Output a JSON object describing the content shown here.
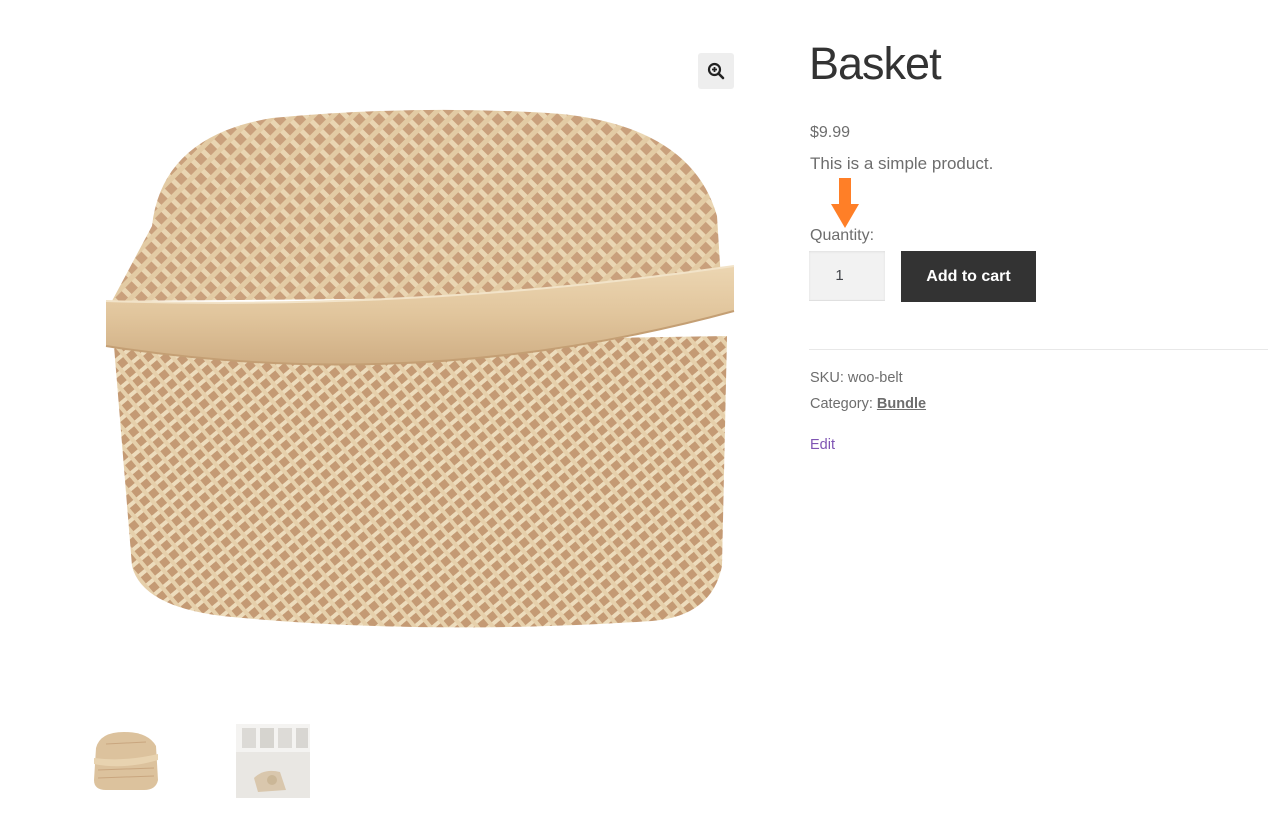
{
  "product": {
    "title": "Basket",
    "price": "$9.99",
    "short_description": "This is a simple product.",
    "quantity_label": "Quantity:",
    "quantity_value": "1",
    "add_to_cart_label": "Add to cart",
    "sku_label": "SKU:",
    "sku_value": "woo-belt",
    "category_label": "Category:",
    "category_value": "Bundle",
    "edit_label": "Edit"
  },
  "gallery": {
    "zoom_icon": "zoom-in-icon",
    "thumbnail_count": 2
  },
  "colors": {
    "button_bg": "#333333",
    "annotation_arrow": "#ff7f27",
    "edit_link": "#7f54b3",
    "body_text": "#6d6d6d"
  }
}
